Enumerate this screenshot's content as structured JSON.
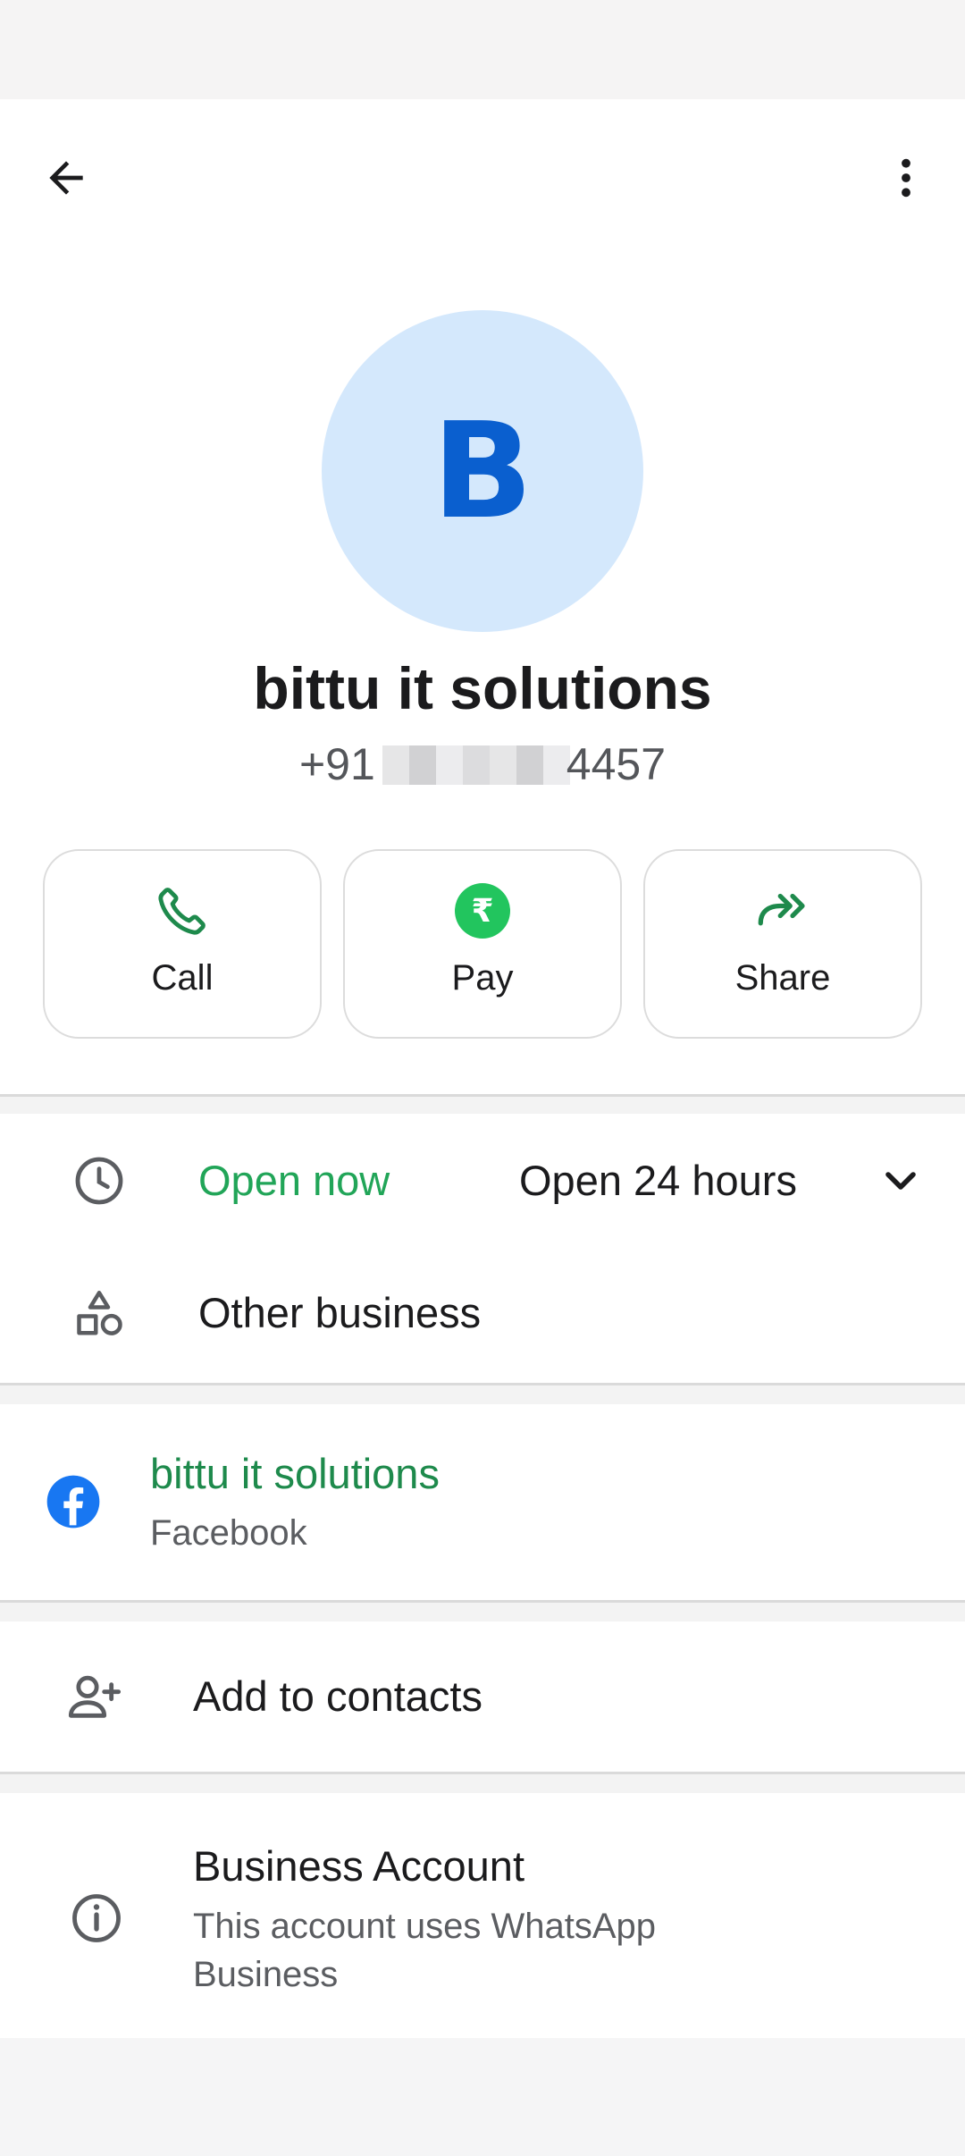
{
  "colors": {
    "accent_green": "#1e8a4c",
    "open_now_green": "#21a558",
    "facebook_blue": "#1877f2",
    "avatar_bg": "#d4e8fc",
    "avatar_letter": "#0a5fcf",
    "pay_green": "#22c55e"
  },
  "profile": {
    "avatar_letter": "B",
    "name": "bittu it solutions",
    "phone_prefix": "+91",
    "phone_suffix": "4457"
  },
  "actions": [
    {
      "label": "Call",
      "icon": "phone-icon"
    },
    {
      "label": "Pay",
      "icon": "rupee-icon",
      "glyph": "₹"
    },
    {
      "label": "Share",
      "icon": "share-forward-icon"
    }
  ],
  "hours": {
    "status": "Open now",
    "detail": "Open 24 hours"
  },
  "category": {
    "label": "Other business",
    "icon": "category-shapes-icon"
  },
  "facebook": {
    "title": "bittu it solutions",
    "subtitle": "Facebook",
    "icon": "facebook-icon"
  },
  "add_contact": {
    "label": "Add to contacts",
    "icon": "add-person-icon"
  },
  "business_account": {
    "title": "Business Account",
    "description": "This account uses WhatsApp Business",
    "icon": "info-icon"
  }
}
